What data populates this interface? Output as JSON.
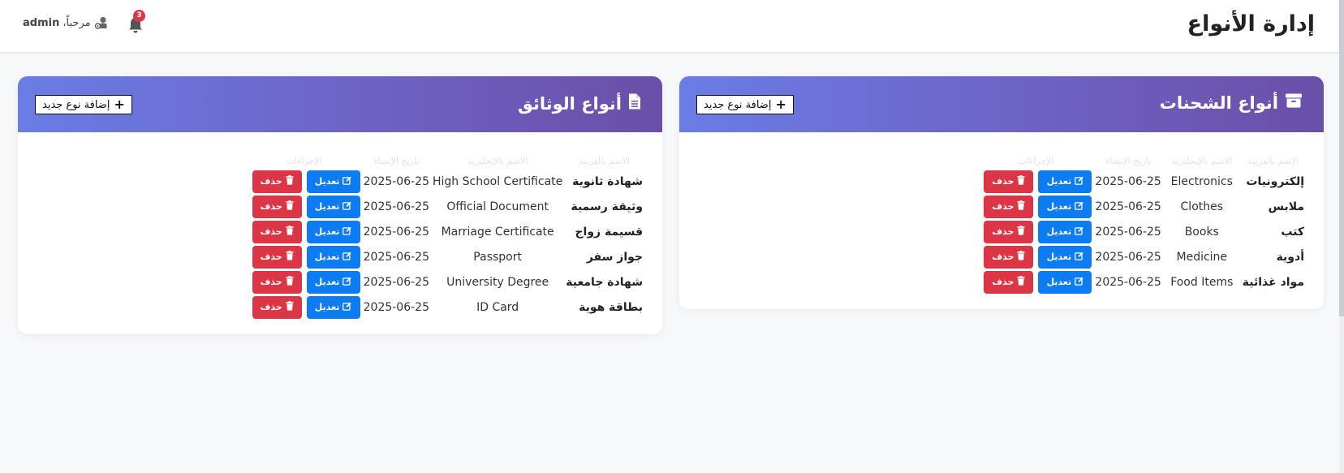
{
  "header": {
    "title": "إدارة الأنواع",
    "greeting": "مرحباً،",
    "username": "admin",
    "notification_count": "3"
  },
  "columns": [
    "الاسم بالعربية",
    "الاسم بالإنجليزية",
    "تاريخ الإنشاء",
    "الإجراءات"
  ],
  "actions": {
    "edit": "تعديل",
    "delete": "حذف"
  },
  "shipments": {
    "title": "أنواع الشحنات",
    "add_label": "إضافة نوع جديد",
    "rows": [
      {
        "ar": "إلكترونيات",
        "en": "Electronics",
        "date": "2025-06-25"
      },
      {
        "ar": "ملابس",
        "en": "Clothes",
        "date": "2025-06-25"
      },
      {
        "ar": "كتب",
        "en": "Books",
        "date": "2025-06-25"
      },
      {
        "ar": "أدوية",
        "en": "Medicine",
        "date": "2025-06-25"
      },
      {
        "ar": "مواد غذائية",
        "en": "Food Items",
        "date": "2025-06-25"
      }
    ]
  },
  "documents": {
    "title": "أنواع الوثائق",
    "add_label": "إضافة نوع جديد",
    "rows": [
      {
        "ar": "شهادة ثانوية",
        "en": "High School Certificate",
        "date": "2025-06-25"
      },
      {
        "ar": "وثيقة رسمية",
        "en": "Official Document",
        "date": "2025-06-25"
      },
      {
        "ar": "قسيمة زواج",
        "en": "Marriage Certificate",
        "date": "2025-06-25"
      },
      {
        "ar": "جواز سفر",
        "en": "Passport",
        "date": "2025-06-25"
      },
      {
        "ar": "شهادة جامعية",
        "en": "University Degree",
        "date": "2025-06-25"
      },
      {
        "ar": "بطاقة هوية",
        "en": "ID Card",
        "date": "2025-06-25"
      }
    ]
  }
}
